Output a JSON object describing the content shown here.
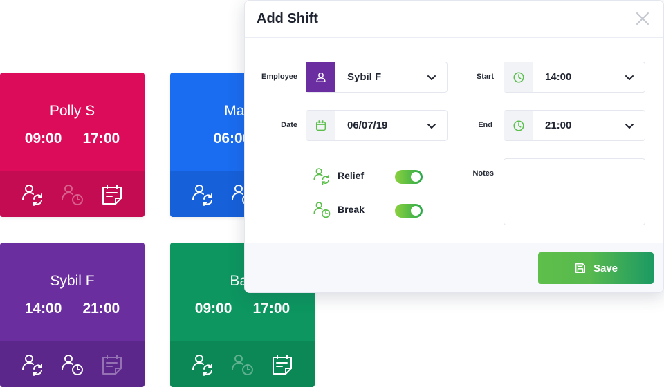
{
  "cards": [
    {
      "name": "Polly S",
      "start": "09:00",
      "end": "17:00",
      "color": "#dc0c5a",
      "footer_color": "#c40c52",
      "icons": {
        "relief": true,
        "break": false,
        "notes": true
      }
    },
    {
      "name": "Manu",
      "start": "06:00",
      "end": "",
      "color": "#1a6cf0",
      "footer_color": "#1660da",
      "icons": {
        "relief": true,
        "break": true,
        "notes": false
      }
    },
    {
      "name": "Sybil F",
      "start": "14:00",
      "end": "21:00",
      "color": "#6a2e9e",
      "footer_color": "#5c278b",
      "icons": {
        "relief": true,
        "break": true,
        "notes": false
      }
    },
    {
      "name": "Bas",
      "start": "09:00",
      "end": "17:00",
      "color": "#0d9660",
      "footer_color": "#0c8756",
      "icons": {
        "relief": true,
        "break": false,
        "notes": true
      }
    }
  ],
  "modal": {
    "title": "Add Shift",
    "employee": {
      "label": "Employee",
      "value": "Sybil F"
    },
    "date": {
      "label": "Date",
      "value": "06/07/19"
    },
    "start": {
      "label": "Start",
      "value": "14:00"
    },
    "end": {
      "label": "End",
      "value": "21:00"
    },
    "relief": {
      "label": "Relief",
      "enabled": true
    },
    "break": {
      "label": "Break",
      "enabled": true
    },
    "notes": {
      "label": "Notes",
      "value": "",
      "placeholder": ""
    },
    "save_label": "Save"
  },
  "colors": {
    "accent_green": "#4cb848",
    "employee_purple": "#6a2ea0"
  }
}
